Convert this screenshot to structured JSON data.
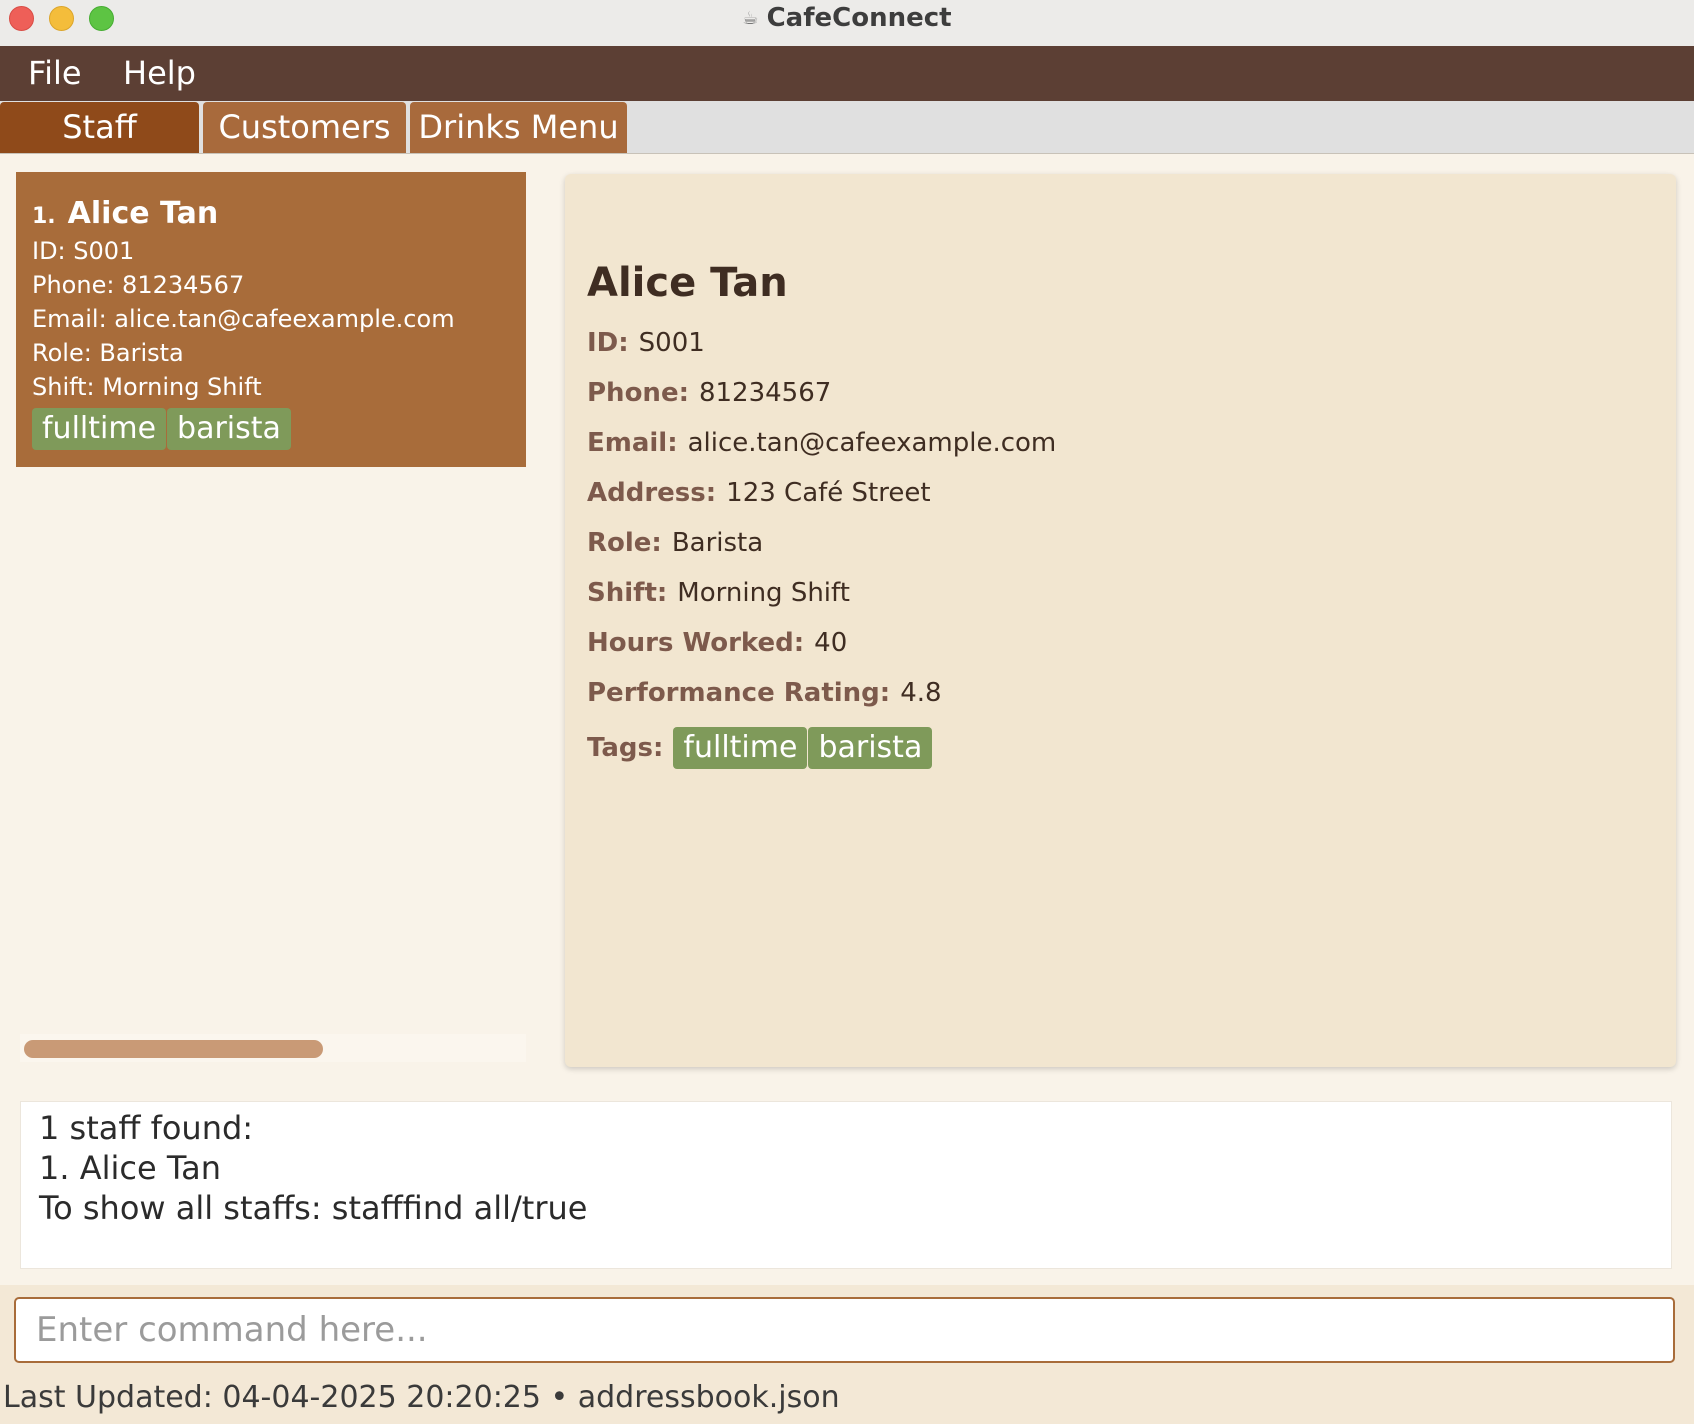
{
  "window": {
    "title": "CafeConnect",
    "icon": "coffee-cup-icon"
  },
  "menu": {
    "file": "File",
    "help": "Help"
  },
  "tabs": [
    {
      "label": "Staff",
      "active": true
    },
    {
      "label": "Customers",
      "active": false
    },
    {
      "label": "Drinks Menu",
      "active": false
    }
  ],
  "staff_list": [
    {
      "index": "1.",
      "name": "Alice Tan",
      "id_line": "ID: S001",
      "phone_line": "Phone: 81234567",
      "email_line": "Email: alice.tan@cafeexample.com",
      "role_line": "Role: Barista",
      "shift_line": "Shift: Morning Shift",
      "tags": [
        "fulltime",
        "barista"
      ]
    }
  ],
  "details": {
    "name": "Alice Tan",
    "id_label": "ID:",
    "id": "S001",
    "phone_label": "Phone:",
    "phone": "81234567",
    "email_label": "Email:",
    "email": "alice.tan@cafeexample.com",
    "address_label": "Address:",
    "address": "123 Café Street",
    "role_label": "Role:",
    "role": "Barista",
    "shift_label": "Shift:",
    "shift": "Morning Shift",
    "hours_label": "Hours Worked:",
    "hours": "40",
    "rating_label": "Performance Rating:",
    "rating": "4.8",
    "tags_label": "Tags:",
    "tags": [
      "fulltime",
      "barista"
    ]
  },
  "result": {
    "line1": "1 staff found:",
    "line2": "1. Alice Tan",
    "line3": "To show all staffs: stafffind all/true"
  },
  "command": {
    "placeholder": "Enter command here...",
    "value": ""
  },
  "status": {
    "text": "Last Updated: 04-04-2025 20:20:25 • addressbook.json"
  },
  "colors": {
    "menubar": "#5c3f34",
    "tab_active": "#8f4a1a",
    "tab_inactive": "#a86a3c",
    "card": "#a86c3a",
    "tag": "#7f9a5a",
    "details_bg": "#f2e6d0"
  }
}
